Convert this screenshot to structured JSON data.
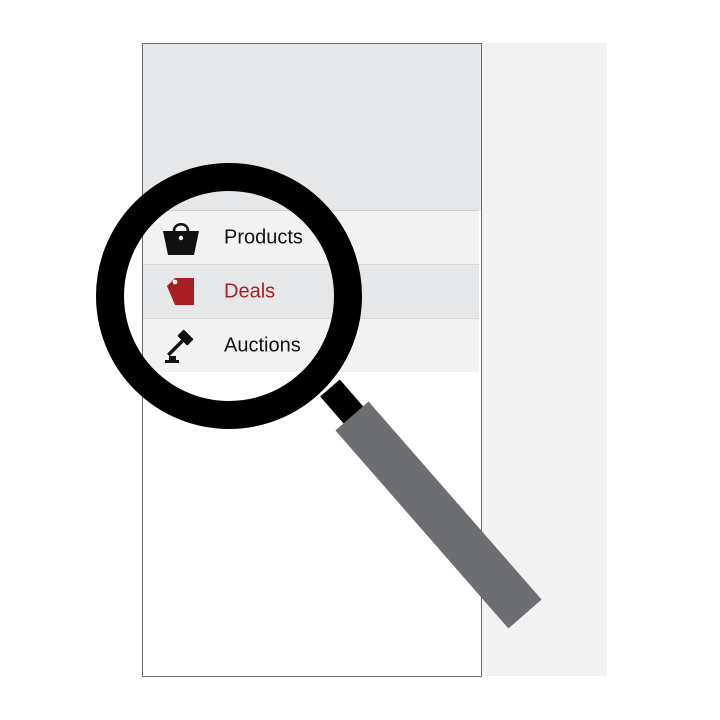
{
  "colors": {
    "active_text": "#a81e22",
    "icon_default": "#111111",
    "header_fill": "#e6e7e8",
    "row_fill": "#f2f2f2",
    "magnifier_ring": "#000000",
    "magnifier_handle": "#6d6e71"
  },
  "menu": {
    "items": [
      {
        "label": "Products",
        "icon": "shopping-bag-icon",
        "state": "default"
      },
      {
        "label": "Deals",
        "icon": "price-tag-icon",
        "state": "active"
      },
      {
        "label": "Auctions",
        "icon": "gavel-icon",
        "state": "default"
      }
    ]
  }
}
